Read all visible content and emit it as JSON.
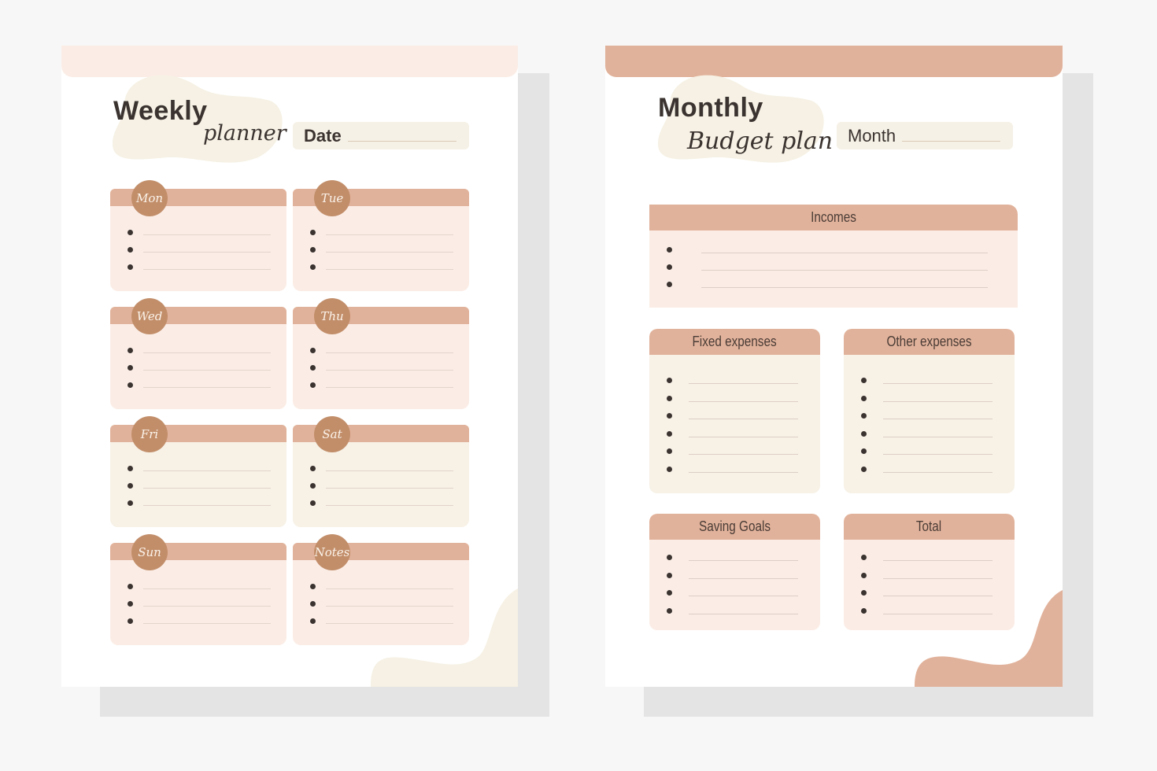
{
  "colors": {
    "background": "#f7f7f7",
    "shadow": "#e4e4e4",
    "accent_header": "#e1b29b",
    "badge": "#c28e6a",
    "pink_fill": "#fbede6",
    "cream_fill": "#f7f1e6",
    "text_dark": "#3a3330"
  },
  "weekly": {
    "title": "Weekly",
    "subtitle": "planner",
    "date_label": "Date",
    "days": [
      {
        "label": "Mon",
        "fill": "pink",
        "rows": 3
      },
      {
        "label": "Tue",
        "fill": "pink",
        "rows": 3
      },
      {
        "label": "Wed",
        "fill": "pink",
        "rows": 3
      },
      {
        "label": "Thu",
        "fill": "pink",
        "rows": 3
      },
      {
        "label": "Fri",
        "fill": "cream",
        "rows": 3
      },
      {
        "label": "Sat",
        "fill": "cream",
        "rows": 3
      },
      {
        "label": "Sun",
        "fill": "pink",
        "rows": 3
      },
      {
        "label": "Notes",
        "fill": "pink",
        "rows": 3
      }
    ]
  },
  "monthly": {
    "title": "Monthly",
    "subtitle": "Budget plan",
    "month_label": "Month",
    "sections": [
      {
        "label": "Incomes",
        "fill": "pink",
        "rows": 3
      },
      {
        "label": "Fixed expenses",
        "fill": "cream",
        "rows": 6
      },
      {
        "label": "Other expenses",
        "fill": "cream",
        "rows": 6
      },
      {
        "label": "Saving Goals",
        "fill": "pink",
        "rows": 4
      },
      {
        "label": "Total",
        "fill": "pink",
        "rows": 4
      }
    ]
  }
}
